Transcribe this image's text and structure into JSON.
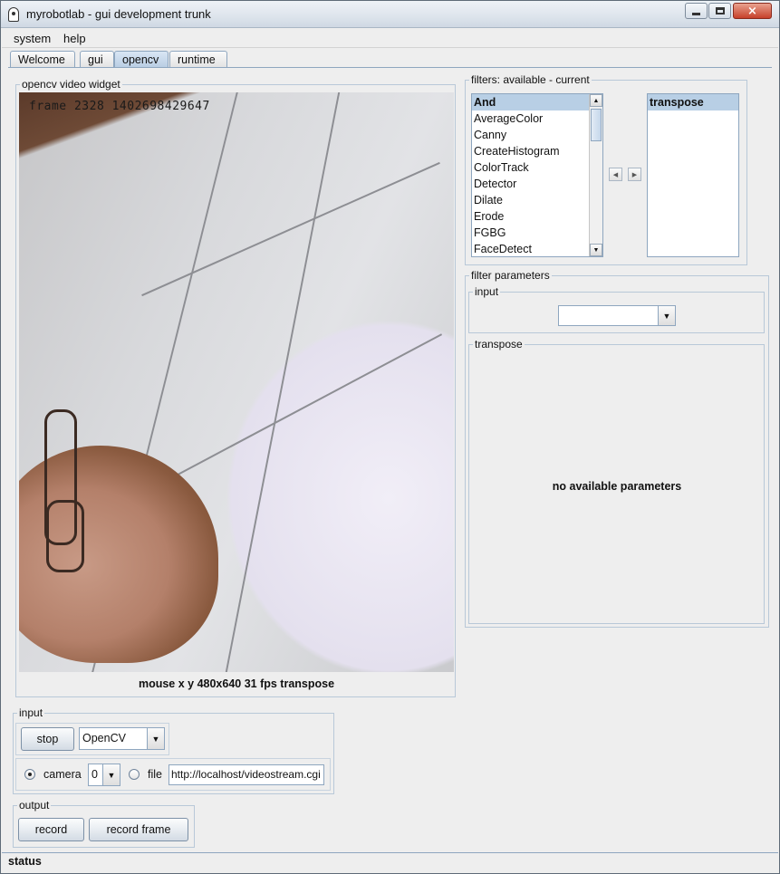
{
  "window": {
    "title": "myrobotlab - gui development trunk",
    "controls": {
      "minimize": "minimize",
      "maximize": "maximize",
      "close": "×"
    }
  },
  "menu": {
    "items": [
      "system",
      "help"
    ]
  },
  "tabs": {
    "items": [
      "Welcome",
      "gui",
      "opencv",
      "runtime"
    ],
    "active": "opencv"
  },
  "video_widget": {
    "title": "opencv  video widget",
    "overlay_text": "frame 2328 1402698429647",
    "status": "mouse x y  480x640  31 fps  transpose"
  },
  "filters": {
    "title": "filters: available - current",
    "available": [
      "And",
      "AverageColor",
      "Canny",
      "CreateHistogram",
      "ColorTrack",
      "Detector",
      "Dilate",
      "Erode",
      "FGBG",
      "FaceDetect"
    ],
    "available_selected": "And",
    "current": [
      "transpose"
    ],
    "scroll_up": "▲",
    "scroll_down": "▼",
    "move_left": "◀",
    "move_right": "▶"
  },
  "filter_parameters": {
    "title": "filter parameters",
    "input_title": "input",
    "input_value": "",
    "section_title": "transpose",
    "message": "no available parameters"
  },
  "input_panel": {
    "title": "input",
    "stop_label": "stop",
    "grabber_value": "OpenCV",
    "camera_label": "camera",
    "camera_index": "0",
    "file_label": "file",
    "file_value": "http://localhost/videostream.cgi",
    "camera_selected": true
  },
  "output_panel": {
    "title": "output",
    "record_label": "record",
    "record_frame_label": "record frame"
  },
  "status_bar": {
    "text": "status"
  },
  "colors": {
    "accent": "#b8cfe5",
    "border": "#8ea6bf",
    "background": "#eeeeee"
  },
  "icons": {
    "app": "robot-icon",
    "dropdown": "chevron-down-icon"
  }
}
